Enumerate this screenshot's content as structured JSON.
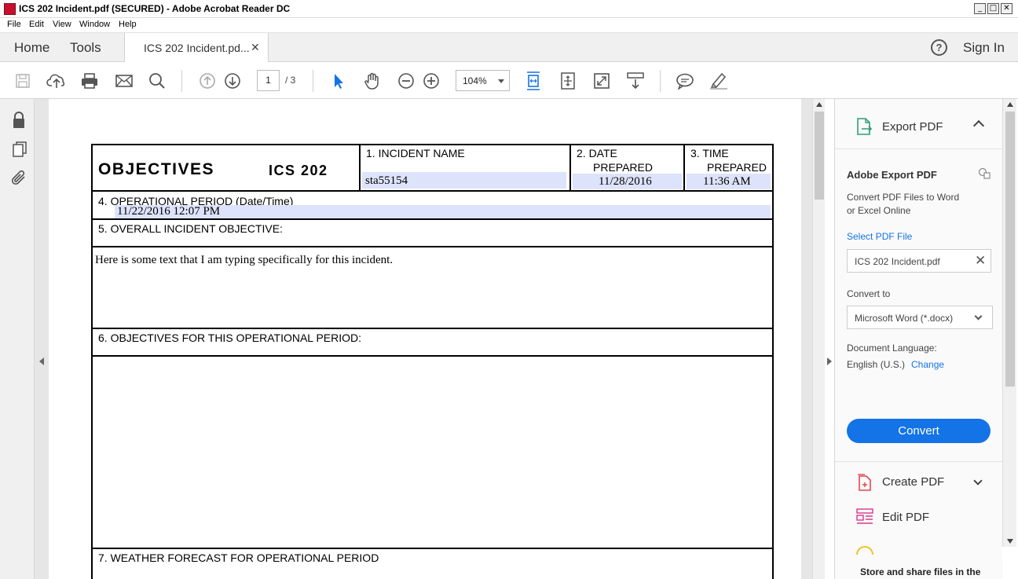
{
  "window": {
    "title": "ICS 202 Incident.pdf (SECURED) - Adobe Acrobat Reader DC",
    "minimize": "_",
    "maximize": "□",
    "close": "✕"
  },
  "menu": [
    "File",
    "Edit",
    "View",
    "Window",
    "Help"
  ],
  "tabs": {
    "home": "Home",
    "tools": "Tools",
    "document": "ICS 202 Incident.pd...",
    "close": "✕",
    "help": "?",
    "sign_in": "Sign In"
  },
  "toolbar": {
    "icons": [
      "save-icon",
      "upload-icon",
      "print-icon",
      "email-icon",
      "search-icon",
      "page-up-icon",
      "page-down-icon",
      "select-cursor-icon",
      "hand-icon",
      "zoom-out-icon",
      "zoom-in-icon",
      "fit-page-icon",
      "fit-width-icon",
      "full-screen-icon",
      "scroll-mode-icon",
      "comment-icon",
      "highlight-icon"
    ],
    "page_current": "1",
    "page_total": "/ 3",
    "zoom": "104%",
    "accent_color": "#1473e6"
  },
  "sidebar": {
    "icons": [
      "lock-icon",
      "pages-icon",
      "attachment-icon"
    ]
  },
  "form": {
    "title": "OBJECTIVES",
    "form_code": "ICS 202",
    "field1_label": "1.  INCIDENT NAME",
    "field1_value": "sta55154",
    "field2_label_a": "2.  DATE",
    "field2_label_b": "PREPARED",
    "field2_value": "11/28/2016",
    "field3_label_a": "3.  TIME",
    "field3_label_b": "PREPARED",
    "field3_value": "11:36 AM",
    "field4_label": "4.  OPERATIONAL PERIOD (Date/Time)",
    "field4_value": "11/22/2016 12:07 PM",
    "field5_label": "5.  OVERALL INCIDENT OBJECTIVE:",
    "field5_value": "Here is some text that I am typing specifically for this incident.",
    "field6_label": "6.  OBJECTIVES FOR THIS OPERATIONAL PERIOD:",
    "field7_label": "7.  WEATHER FORECAST FOR OPERATIONAL PERIOD",
    "fill_color": "#dde3fa"
  },
  "right_pane": {
    "header": "Export PDF",
    "section_title": "Adobe Export PDF",
    "description_line1": "Convert PDF Files to Word",
    "description_line2": "or Excel Online",
    "select_file_label": "Select PDF File",
    "selected_file": "ICS 202 Incident.pdf",
    "convert_to_label": "Convert to",
    "convert_to_value": "Microsoft Word (*.docx)",
    "doc_language_label": "Document Language:",
    "doc_language_value": "English (U.S.)",
    "change_link": "Change",
    "convert_button": "Convert",
    "create_pdf": "Create PDF",
    "edit_pdf": "Edit PDF",
    "footer_text": "Store and share files in the"
  }
}
